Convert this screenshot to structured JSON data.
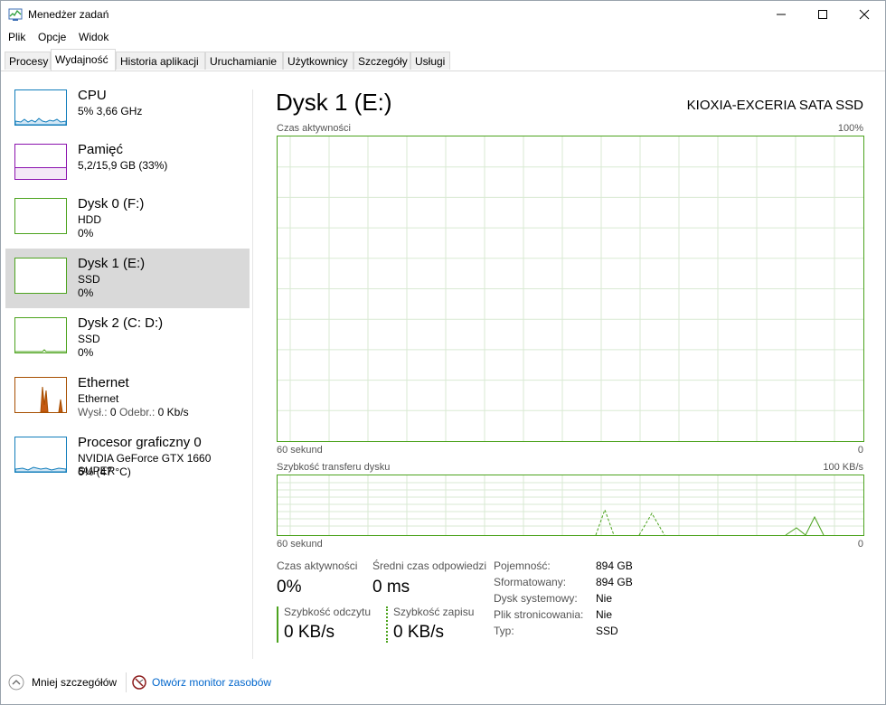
{
  "window": {
    "title": "Menedżer zadań"
  },
  "menu": [
    "Plik",
    "Opcje",
    "Widok"
  ],
  "tabs": [
    {
      "label": "Procesy",
      "active": false
    },
    {
      "label": "Wydajność",
      "active": true
    },
    {
      "label": "Historia aplikacji",
      "active": false
    },
    {
      "label": "Uruchamianie",
      "active": false
    },
    {
      "label": "Użytkownicy",
      "active": false
    },
    {
      "label": "Szczegóły",
      "active": false
    },
    {
      "label": "Usługi",
      "active": false
    }
  ],
  "sidebar": {
    "items": [
      {
        "title": "CPU",
        "line1": "5%  3,66 GHz",
        "line2": "",
        "color": "#117dbb",
        "selected": false
      },
      {
        "title": "Pamięć",
        "line1": "5,2/15,9 GB (33%)",
        "line2": "",
        "color": "#8b12ae",
        "selected": false
      },
      {
        "title": "Dysk 0 (F:)",
        "line1": "HDD",
        "line2": "0%",
        "color": "#4ca31e",
        "selected": false
      },
      {
        "title": "Dysk 1 (E:)",
        "line1": "SSD",
        "line2": "0%",
        "color": "#4ca31e",
        "selected": true
      },
      {
        "title": "Dysk 2 (C: D:)",
        "line1": "SSD",
        "line2": "0%",
        "color": "#4ca31e",
        "selected": false
      },
      {
        "title": "Ethernet",
        "line1": "Ethernet",
        "line2_label1": "Wysł.:",
        "line2_val1": "0",
        "line2_label2": "Odebr.:",
        "line2_val2": "0 Kb/s",
        "color": "#a74f01",
        "selected": false
      },
      {
        "title": "Procesor graficzny 0",
        "line1": "NVIDIA GeForce GTX 1660 SUPER",
        "line2": "6%  (47 °C)",
        "color": "#117dbb",
        "selected": false
      }
    ]
  },
  "main": {
    "title": "Dysk 1 (E:)",
    "model": "KIOXIA-EXCERIA SATA SSD",
    "graph1": {
      "label": "Czas aktywności",
      "max": "100%",
      "time": "60 sekund",
      "min": "0"
    },
    "graph2": {
      "label": "Szybkość transferu dysku",
      "max": "100 KB/s",
      "time": "60 sekund",
      "min": "0"
    },
    "stats": {
      "active_label": "Czas aktywności",
      "active_value": "0%",
      "resp_label": "Średni czas odpowiedzi",
      "resp_value": "0 ms",
      "read_label": "Szybkość odczytu",
      "read_value": "0 KB/s",
      "write_label": "Szybkość zapisu",
      "write_value": "0 KB/s"
    },
    "props": [
      {
        "label": "Pojemność:",
        "value": "894 GB"
      },
      {
        "label": "Sformatowany:",
        "value": "894 GB"
      },
      {
        "label": "Dysk systemowy:",
        "value": "Nie"
      },
      {
        "label": "Plik stronicowania:",
        "value": "Nie"
      },
      {
        "label": "Typ:",
        "value": "SSD"
      }
    ]
  },
  "footer": {
    "less_details": "Mniej szczegółów",
    "resource_monitor": "Otwórz monitor zasobów"
  }
}
